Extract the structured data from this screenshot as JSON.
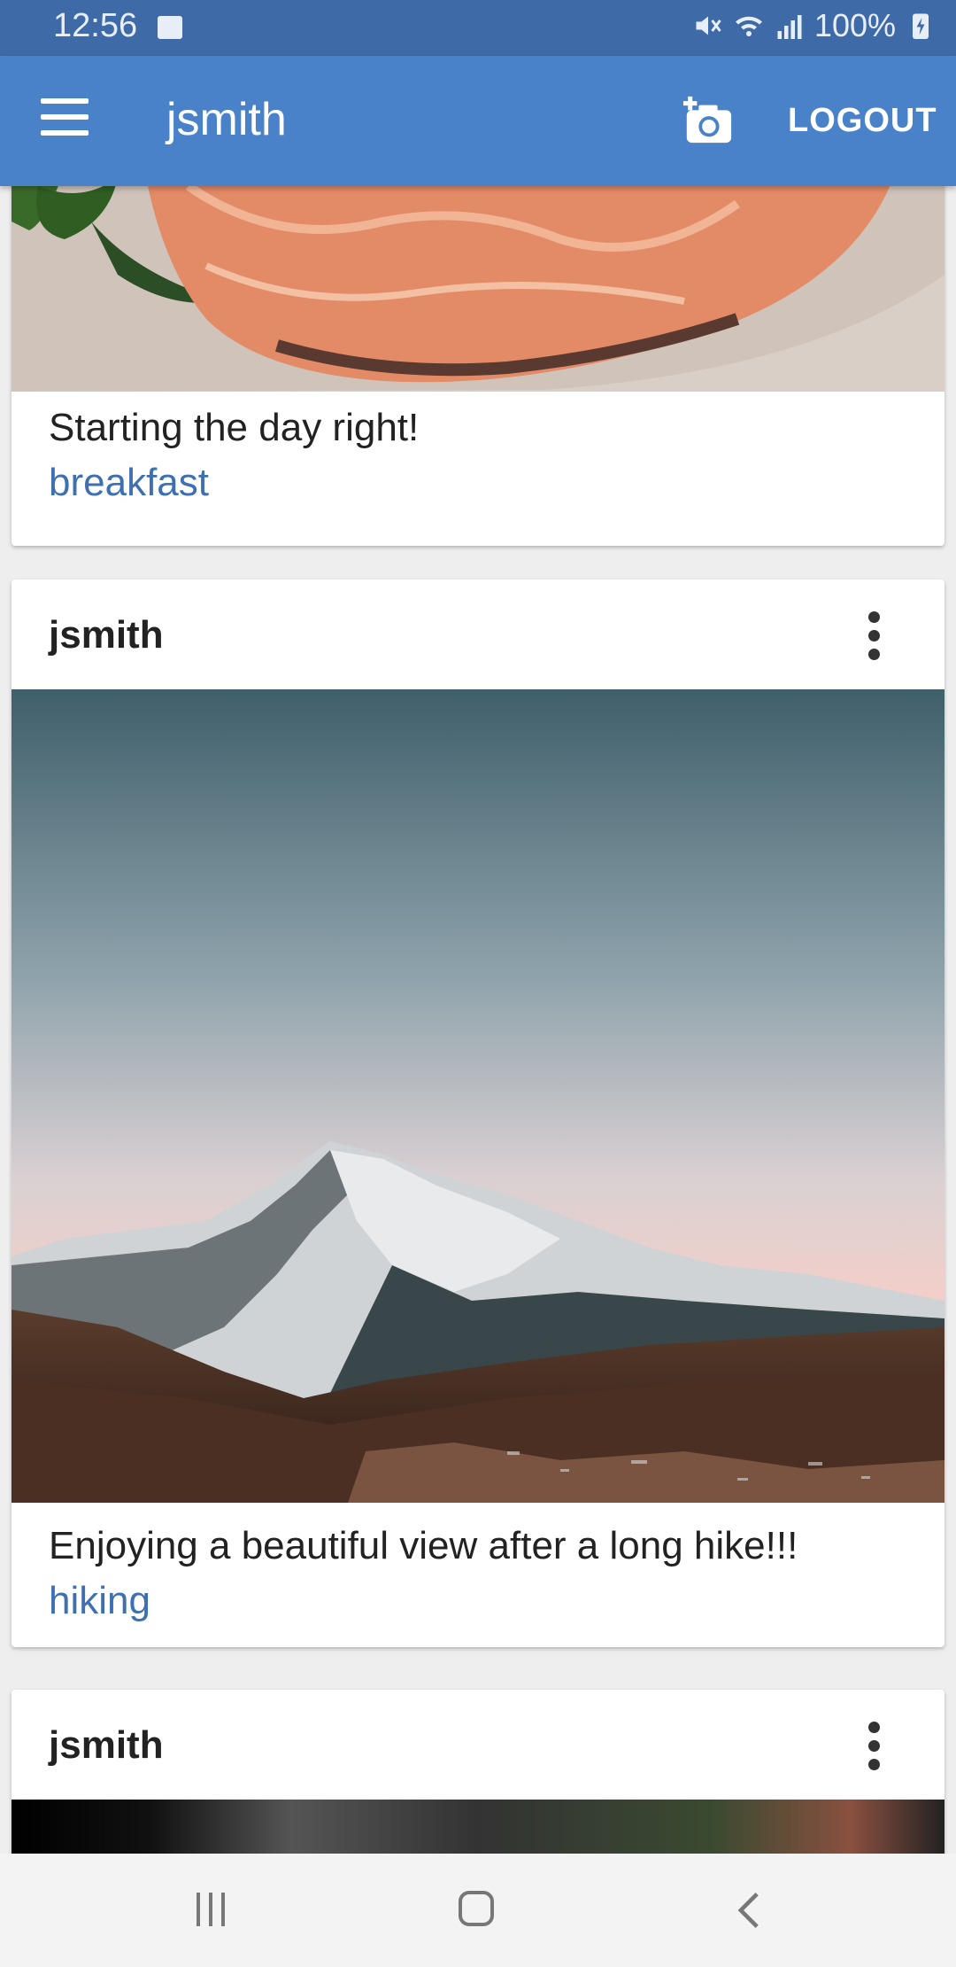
{
  "status_bar": {
    "time": "12:56",
    "battery": "100%",
    "icons": [
      "image-icon",
      "mute-icon",
      "wifi-icon",
      "signal-icon",
      "battery-charging-icon"
    ]
  },
  "app_bar": {
    "title": "jsmith",
    "logout_label": "LOGOUT",
    "accent_color": "#4a82c9",
    "icons": [
      "menu-icon",
      "add-photo-icon"
    ]
  },
  "feed": {
    "posts": [
      {
        "caption": "Starting the day right!",
        "tag": "breakfast",
        "photo": "salmon-dish"
      },
      {
        "user": "jsmith",
        "caption": "Enjoying a beautiful view after a long hike!!!",
        "tag": "hiking",
        "photo": "snowy-mountain-landscape"
      },
      {
        "user": "jsmith",
        "photo": "dark-blurred-photo"
      }
    ],
    "tag_color": "#3e6fb0"
  },
  "nav_bar": {
    "icons": [
      "recent-apps-icon",
      "home-icon",
      "back-icon"
    ]
  }
}
